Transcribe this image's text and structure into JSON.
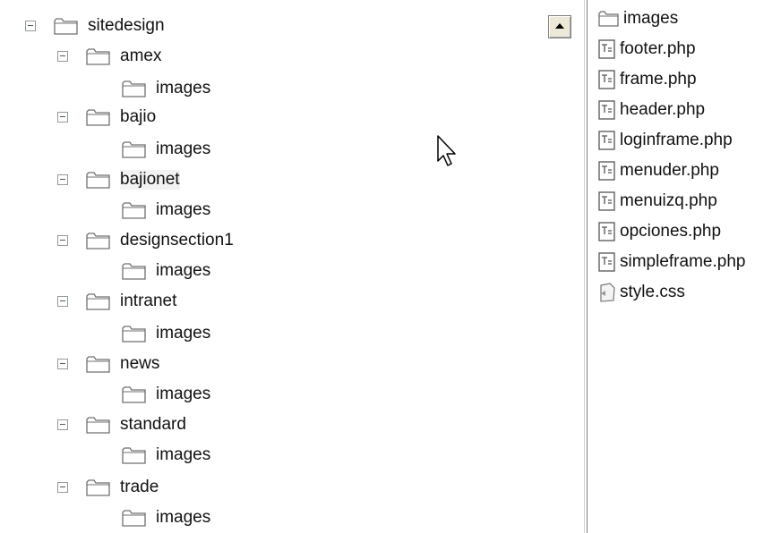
{
  "tree": {
    "root_label": "sitedesign",
    "children": [
      {
        "label": "amex",
        "child": "images"
      },
      {
        "label": "bajio",
        "child": "images"
      },
      {
        "label": "bajionet",
        "child": "images"
      },
      {
        "label": "designsection1",
        "child": "images"
      },
      {
        "label": "intranet",
        "child": "images"
      },
      {
        "label": "news",
        "child": "images"
      },
      {
        "label": "standard",
        "child": "images"
      },
      {
        "label": "trade",
        "child": "images"
      }
    ]
  },
  "files": {
    "items": [
      {
        "name": "images",
        "icon": "folder-icon"
      },
      {
        "name": "footer.php",
        "icon": "php-file-icon"
      },
      {
        "name": "frame.php",
        "icon": "php-file-icon"
      },
      {
        "name": "header.php",
        "icon": "php-file-icon"
      },
      {
        "name": "loginframe.php",
        "icon": "php-file-icon"
      },
      {
        "name": "menuder.php",
        "icon": "php-file-icon"
      },
      {
        "name": "menuizq.php",
        "icon": "php-file-icon"
      },
      {
        "name": "opciones.php",
        "icon": "php-file-icon"
      },
      {
        "name": "simpleframe.php",
        "icon": "php-file-icon"
      },
      {
        "name": "style.css",
        "icon": "css-file-icon"
      }
    ]
  }
}
